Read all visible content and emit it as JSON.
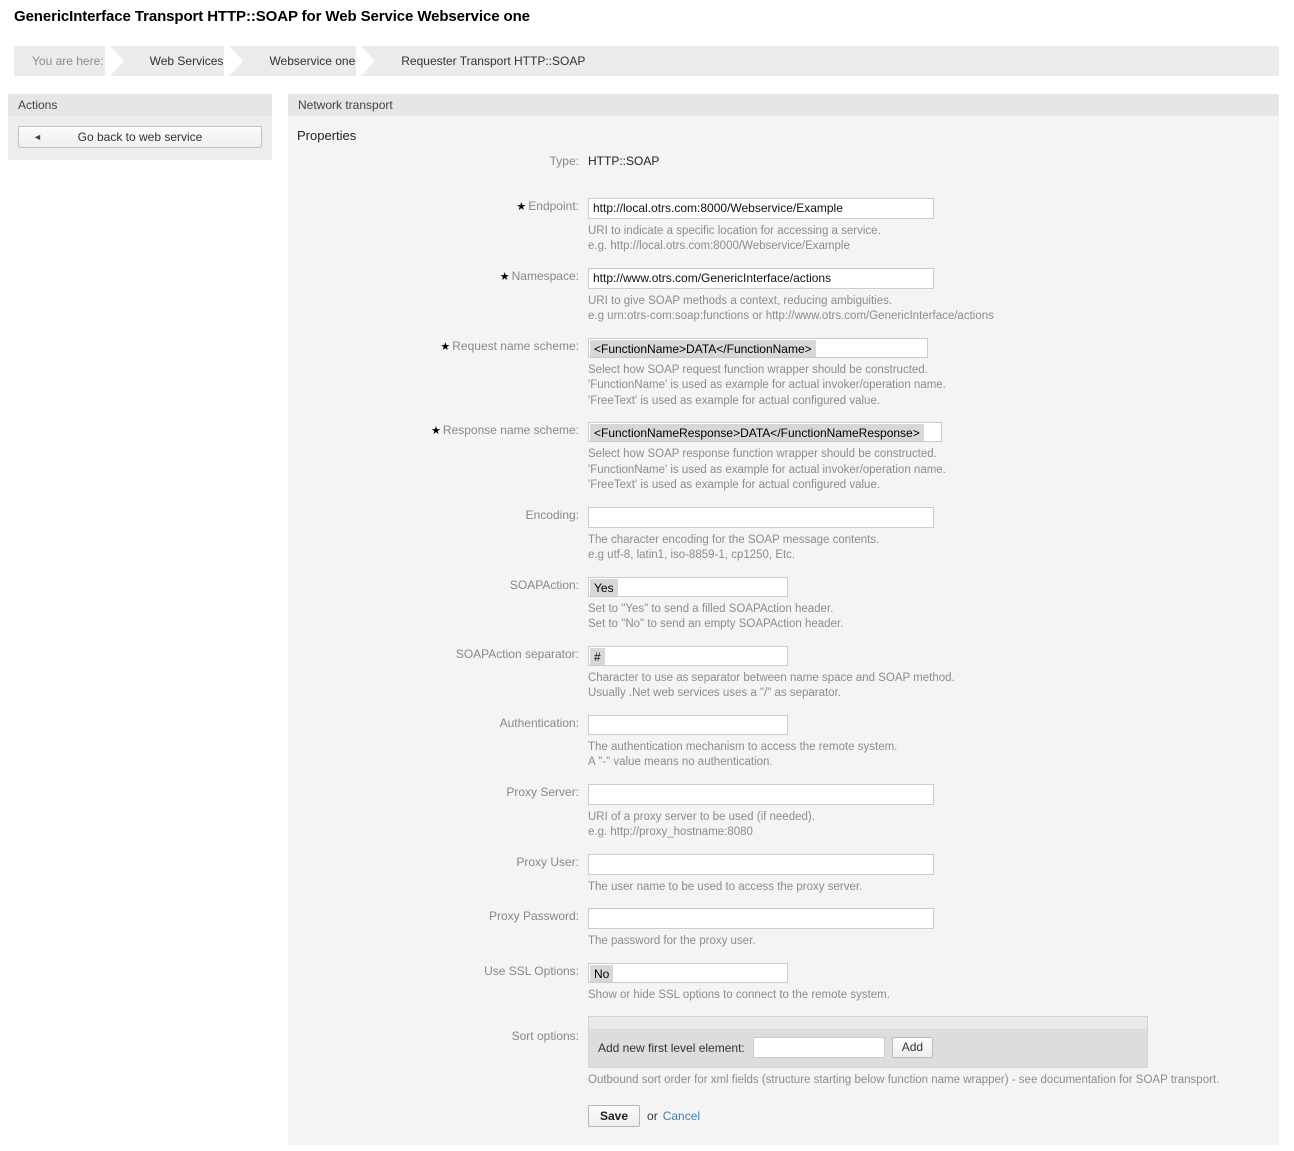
{
  "page": {
    "title": "GenericInterface Transport HTTP::SOAP for Web Service Webservice one"
  },
  "breadcrumb": {
    "prefix": "You are here:",
    "items": [
      {
        "label": "Web Services"
      },
      {
        "label": "Webservice one"
      },
      {
        "label": "Requester Transport HTTP::SOAP"
      }
    ]
  },
  "sidebar": {
    "header": "Actions",
    "back_button": "Go back to web service"
  },
  "content": {
    "header": "Network transport",
    "section_title": "Properties"
  },
  "form": {
    "required_mark": "★",
    "type": {
      "label": "Type:",
      "value": "HTTP::SOAP"
    },
    "endpoint": {
      "label": "Endpoint:",
      "value": "http://local.otrs.com:8000/Webservice/Example",
      "hint1": "URI to indicate a specific location for accessing a service.",
      "hint2": "e.g. http://local.otrs.com:8000/Webservice/Example"
    },
    "namespace": {
      "label": "Namespace:",
      "value": "http://www.otrs.com/GenericInterface/actions",
      "hint1": "URI to give SOAP methods a context, reducing ambiguities.",
      "hint2": "e.g urn:otrs-com:soap:functions or http://www.otrs.com/GenericInterface/actions"
    },
    "request_name_scheme": {
      "label": "Request name scheme:",
      "selected": "<FunctionName>DATA</FunctionName>",
      "hint1": "Select how SOAP request function wrapper should be constructed.",
      "hint2": "'FunctionName' is used as example for actual invoker/operation name.",
      "hint3": "'FreeText' is used as example for actual configured value."
    },
    "response_name_scheme": {
      "label": "Response name scheme:",
      "selected": "<FunctionNameResponse>DATA</FunctionNameResponse>",
      "hint1": "Select how SOAP response function wrapper should be constructed.",
      "hint2": "'FunctionName' is used as example for actual invoker/operation name.",
      "hint3": "'FreeText' is used as example for actual configured value."
    },
    "encoding": {
      "label": "Encoding:",
      "value": "",
      "hint1": "The character encoding for the SOAP message contents.",
      "hint2": "e.g utf-8, latin1, iso-8859-1, cp1250, Etc."
    },
    "soapaction": {
      "label": "SOAPAction:",
      "selected": "Yes",
      "hint1": "Set to \"Yes\" to send a filled SOAPAction header.",
      "hint2": "Set to \"No\" to send an empty SOAPAction header."
    },
    "soapaction_separator": {
      "label": "SOAPAction separator:",
      "selected": "#",
      "hint1": "Character to use as separator between name space and SOAP method.",
      "hint2": "Usually .Net web services uses a \"/\" as separator."
    },
    "authentication": {
      "label": "Authentication:",
      "selected": "",
      "hint1": "The authentication mechanism to access the remote system.",
      "hint2": "A \"-\" value means no authentication."
    },
    "proxy_server": {
      "label": "Proxy Server:",
      "value": "",
      "hint1": "URI of a proxy server to be used (if needed).",
      "hint2": "e.g. http://proxy_hostname:8080"
    },
    "proxy_user": {
      "label": "Proxy User:",
      "value": "",
      "hint1": "The user name to be used to access the proxy server."
    },
    "proxy_password": {
      "label": "Proxy Password:",
      "value": "",
      "hint1": "The password for the proxy user."
    },
    "use_ssl_options": {
      "label": "Use SSL Options:",
      "selected": "No",
      "hint1": "Show or hide SSL options to connect to the remote system."
    },
    "sort_options": {
      "label": "Sort options:",
      "add_label": "Add new first level element:",
      "add_value": "",
      "add_button": "Add",
      "hint1": "Outbound sort order for xml fields (structure starting below function name wrapper) - see documentation for SOAP transport."
    },
    "submit": {
      "save": "Save",
      "or": "or",
      "cancel": "Cancel"
    }
  }
}
